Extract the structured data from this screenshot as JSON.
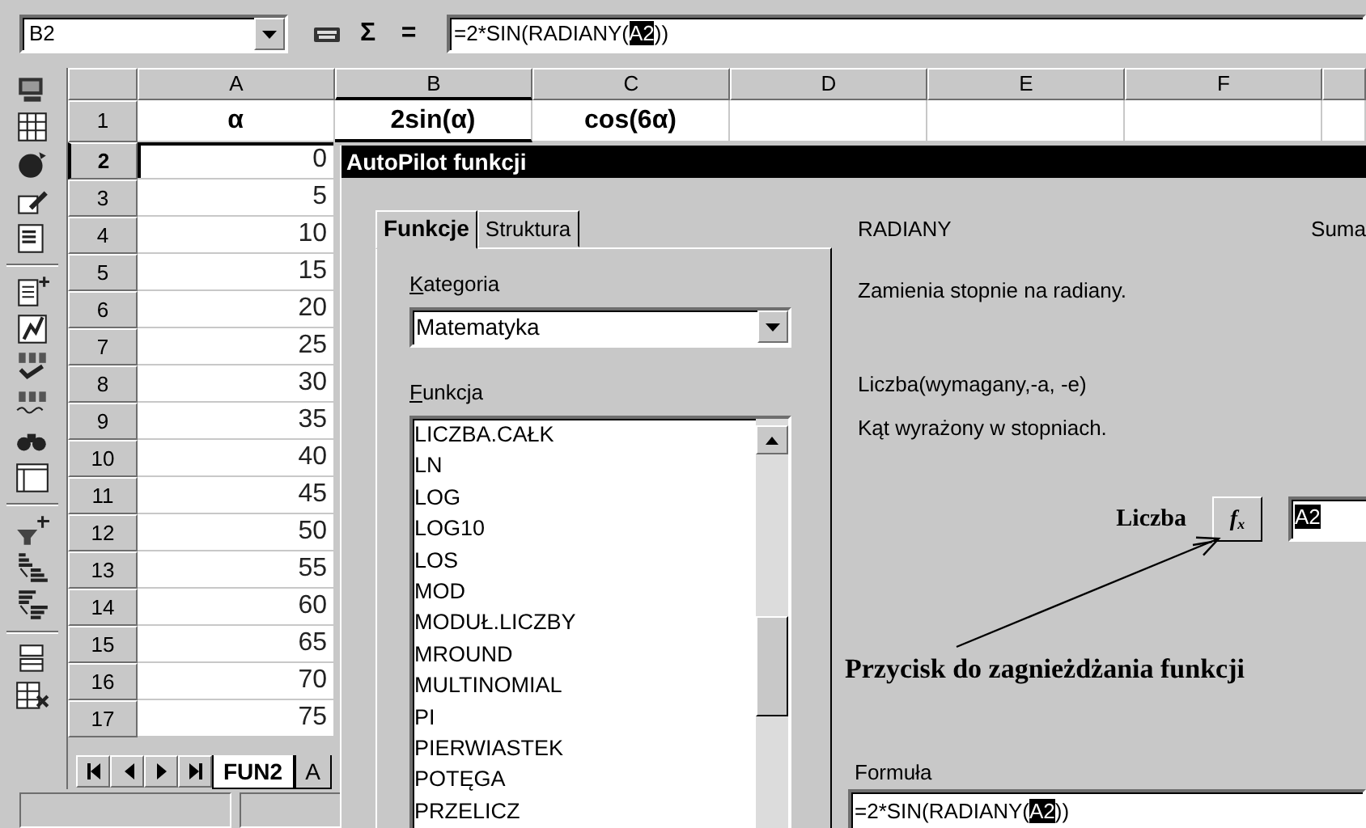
{
  "formula_bar": {
    "name_box": "B2",
    "buttons": [
      "Σ",
      "="
    ],
    "formula": {
      "before": "=2*SIN(RADIANY(",
      "selected": "A2",
      "after": "))"
    }
  },
  "columns": [
    {
      "label": "A",
      "selected": false
    },
    {
      "label": "B",
      "selected": true
    },
    {
      "label": "C",
      "selected": false
    },
    {
      "label": "D",
      "selected": false
    },
    {
      "label": "E",
      "selected": false
    },
    {
      "label": "F",
      "selected": false
    }
  ],
  "rows": [
    {
      "header": "1",
      "kind": "title",
      "selected": false,
      "cells": [
        "α",
        "2sin(α)",
        "cos(6α)"
      ]
    },
    {
      "header": "2",
      "kind": "number",
      "selected": true,
      "cells": [
        "0"
      ]
    },
    {
      "header": "3",
      "kind": "number",
      "selected": false,
      "cells": [
        "5"
      ]
    },
    {
      "header": "4",
      "kind": "number",
      "selected": false,
      "cells": [
        "10"
      ]
    },
    {
      "header": "5",
      "kind": "number",
      "selected": false,
      "cells": [
        "15"
      ]
    },
    {
      "header": "6",
      "kind": "number",
      "selected": false,
      "cells": [
        "20"
      ]
    },
    {
      "header": "7",
      "kind": "number",
      "selected": false,
      "cells": [
        "25"
      ]
    },
    {
      "header": "8",
      "kind": "number",
      "selected": false,
      "cells": [
        "30"
      ]
    },
    {
      "header": "9",
      "kind": "number",
      "selected": false,
      "cells": [
        "35"
      ]
    },
    {
      "header": "10",
      "kind": "number",
      "selected": false,
      "cells": [
        "40"
      ]
    },
    {
      "header": "11",
      "kind": "number",
      "selected": false,
      "cells": [
        "45"
      ]
    },
    {
      "header": "12",
      "kind": "number",
      "selected": false,
      "cells": [
        "50"
      ]
    },
    {
      "header": "13",
      "kind": "number",
      "selected": false,
      "cells": [
        "55"
      ]
    },
    {
      "header": "14",
      "kind": "number",
      "selected": false,
      "cells": [
        "60"
      ]
    },
    {
      "header": "15",
      "kind": "number",
      "selected": false,
      "cells": [
        "65"
      ]
    },
    {
      "header": "16",
      "kind": "number",
      "selected": false,
      "cells": [
        "70"
      ]
    },
    {
      "header": "17",
      "kind": "number",
      "selected": false,
      "cells": [
        "75"
      ]
    }
  ],
  "sheet_tabs": [
    {
      "label": "FUN2",
      "selected": true
    },
    {
      "label": "A",
      "selected": false
    }
  ],
  "dialog": {
    "title": "AutoPilot funkcji",
    "tabs": [
      {
        "label": "Funkcje",
        "selected": true
      },
      {
        "label": "Struktura",
        "selected": false
      }
    ],
    "category_label": {
      "accel": "K",
      "rest": "ategoria"
    },
    "category": "Matematyka",
    "function_label": {
      "accel": "F",
      "rest": "unkcja"
    },
    "functions": [
      "LICZBA.CAŁK",
      "LN",
      "LOG",
      "LOG10",
      "LOS",
      "MOD",
      "MODUŁ.LICZBY",
      "MROUND",
      "MULTINOMIAL",
      "PI",
      "PIERWIASTEK",
      "POTĘGA",
      "PRZELICZ"
    ],
    "function_name": "RADIANY",
    "next_function": "Suma",
    "description": "Zamienia stopnie na radiany.",
    "argument_signature": "Liczba(wymagany,-a, -e)",
    "argument_description": "Kąt wyrażony w stopniach.",
    "argument_label": "Liczba",
    "nest_button": "*f*$_{x}$",
    "argument_value": "A2",
    "formula_label": "Formuła",
    "formula": {
      "before": "=2*SIN(RADIANY(",
      "selected": "A2",
      "after": "))"
    }
  },
  "annotation": {
    "text": "Przycisk do zagnieżdżania funkcji"
  }
}
